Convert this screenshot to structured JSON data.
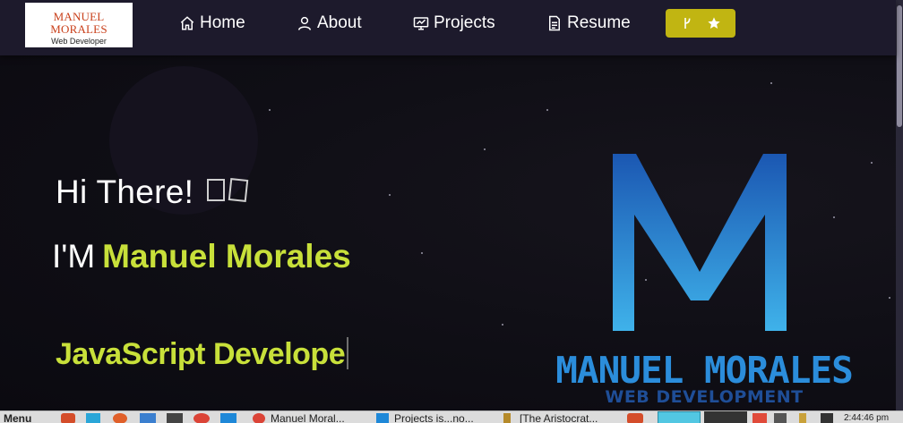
{
  "nav": {
    "logo_title": "MANUEL MORALES",
    "logo_subtitle": "Web Developer",
    "items": [
      {
        "label": "Home",
        "icon": "home-icon"
      },
      {
        "label": "About",
        "icon": "user-icon"
      },
      {
        "label": "Projects",
        "icon": "projects-icon"
      },
      {
        "label": "Resume",
        "icon": "document-icon"
      }
    ],
    "github_button": {
      "icons": [
        "fork-icon",
        "star-icon"
      ],
      "color": "#c1b512"
    }
  },
  "hero": {
    "greeting": "Hi There!",
    "intro_prefix": "I'M",
    "name": "Manuel Morales",
    "typed_text": "JavaScript Develope",
    "accent_color": "#c8e03a"
  },
  "brand": {
    "title": "MANUEL MORALES",
    "subtitle": "WEB DEVELOPMENT",
    "color": "#2b8ddb"
  },
  "taskbar": {
    "menu_label": "Menu",
    "items": [
      {
        "label": "Manuel Moral..."
      },
      {
        "label": "Projects is...no..."
      },
      {
        "label": "[The Aristocrat..."
      }
    ],
    "clock": "2:44:46 pm"
  }
}
